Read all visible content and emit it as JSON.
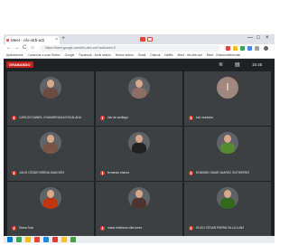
{
  "browser": {
    "tab_title": "Meet - nfv-otrb-wzi",
    "tab_close": "×",
    "new_tab": "+",
    "url": "https://meet.google.com/nfv-otrb-wzi?authuser=0",
    "back": "←",
    "forward": "→",
    "reload": "C",
    "home": "⌂",
    "window_controls": [
      "—",
      "□",
      "×"
    ]
  },
  "bookmarks": [
    "Aplicaciones",
    "Comenzar a usar Firefox",
    "Google",
    "Facebook - Inicie sesión",
    "Nueva sesión",
    "Gmail",
    "Outlook",
    "Netflix",
    "Meet - nfv-otrb-wzi",
    "Meet - Videoconferencias"
  ],
  "meet": {
    "recording_label": "GRABANDO",
    "clock": "15:45",
    "participants": [
      {
        "name": "CARLOS DANIEL CHAVARRIAGA ESCALADA",
        "avatar": "photo",
        "color": "#6d4c41"
      },
      {
        "name": "luis de santiago",
        "avatar": "photo",
        "color": "#8d6e63"
      },
      {
        "name": "luci montalvo",
        "avatar": "letter",
        "letter": "l",
        "color": "#a1887f"
      },
      {
        "name": "JULIO CESAR BRENA SANCHEZ",
        "avatar": "photo",
        "color": "#795548"
      },
      {
        "name": "fernando chavez",
        "avatar": "photo",
        "color": "#212121"
      },
      {
        "name": "EDWARD OMAR JUAREZ GUTIERREZ",
        "avatar": "photo",
        "color": "#558b2f"
      },
      {
        "name": "Diana Soto",
        "avatar": "photo",
        "color": "#bf360c"
      },
      {
        "name": "maria estefania villa torres",
        "avatar": "photo",
        "color": "#4e342e"
      },
      {
        "name": "HUGO CESAR PARRA VILLA LUNA",
        "avatar": "photo",
        "color": "#33691e"
      }
    ]
  },
  "taskbar_colors": [
    "#0078d7",
    "#34a853",
    "#fbbc05",
    "#ea4335",
    "#1e88e5",
    "#e53935",
    "#fbc02d",
    "#43a047"
  ]
}
